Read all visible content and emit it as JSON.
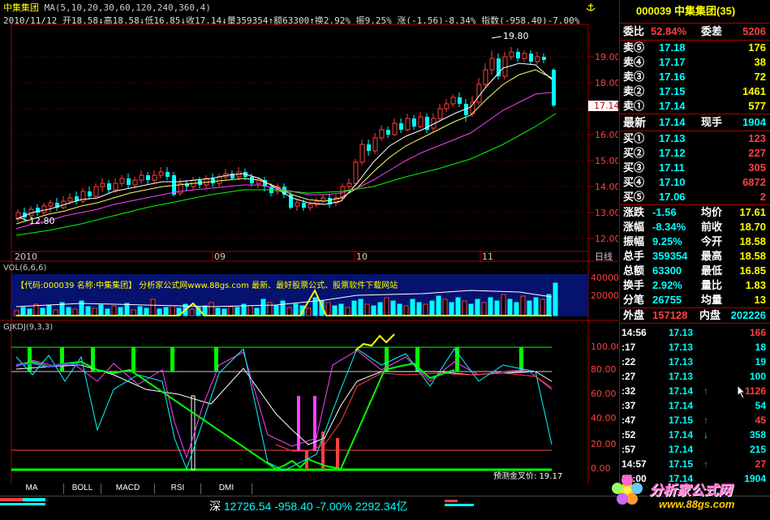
{
  "header": {
    "stock_name": "中集集团",
    "ma_label": "MA(5,10,20,30,60,120,240,360,4)",
    "info": "2010/11/12 开18.58↓高18.58↓低16.85↓收17.14↓量359354↑额63300↑换2.92% 振9.25% 涨(-1.56)-8.34% 指数(-958.40)-7.00%"
  },
  "price_chart": {
    "y_labels": [
      "19.00",
      "18.00",
      "17.00",
      "16.00",
      "15.00",
      "14.00",
      "13.00",
      "12.00"
    ],
    "high_marker": "19.80",
    "low_marker": "12.80",
    "current_price_tag": "17.14",
    "x_labels": [
      "2010",
      "09",
      "10",
      "11"
    ],
    "cycle_label": "日线"
  },
  "vol_panel": {
    "label": "VOL(6,6,6)",
    "watermark": "【代码:000039 名称:中集集团】      分析家公式网www.88gs.com 最新、最好股票公式、股票软件下载网站",
    "y_labels": [
      "400000",
      "200000"
    ]
  },
  "ind_panel": {
    "label": "GJKDJ(9,3,3)",
    "y_labels": [
      "100.00",
      "80.00",
      "60.00",
      "40.00",
      "20.00",
      "0.00"
    ],
    "forecast": "预测金叉价: 19.17"
  },
  "tabs": [
    "MA",
    "BOLL",
    "MACD",
    "RSI",
    "DMI"
  ],
  "quote": {
    "code": "000039",
    "name": "中集集团",
    "num": "(35)",
    "weibi_label": "委比",
    "weibi_val": "52.84%",
    "weicha_label": "委差",
    "weicha_val": "5206",
    "sells": [
      {
        "label": "卖⑤",
        "price": "17.18",
        "vol": "176"
      },
      {
        "label": "卖④",
        "price": "17.17",
        "vol": "38"
      },
      {
        "label": "卖③",
        "price": "17.16",
        "vol": "72"
      },
      {
        "label": "卖②",
        "price": "17.15",
        "vol": "1461"
      },
      {
        "label": "卖①",
        "price": "17.14",
        "vol": "577"
      }
    ],
    "latest_label": "最新",
    "latest_val": "17.14",
    "xianshou_label": "现手",
    "xianshou_val": "1904",
    "buys": [
      {
        "label": "买①",
        "price": "17.13",
        "vol": "123"
      },
      {
        "label": "买②",
        "price": "17.12",
        "vol": "227"
      },
      {
        "label": "买③",
        "price": "17.11",
        "vol": "305"
      },
      {
        "label": "买④",
        "price": "17.10",
        "vol": "6872"
      },
      {
        "label": "买⑤",
        "price": "17.06",
        "vol": "2"
      }
    ],
    "stats": [
      {
        "l1": "涨跌",
        "v1": "-1.56",
        "l2": "均价",
        "v2": "17.61"
      },
      {
        "l1": "涨幅",
        "v1": "-8.34%",
        "l2": "前收",
        "v2": "18.70"
      },
      {
        "l1": "振幅",
        "v1": "9.25%",
        "l2": "今开",
        "v2": "18.58"
      },
      {
        "l1": "总手",
        "v1": "359354",
        "l2": "最高",
        "v2": "18.58"
      },
      {
        "l1": "总额",
        "v1": "63300",
        "l2": "最低",
        "v2": "16.85"
      },
      {
        "l1": "换手",
        "v1": "2.92%",
        "l2": "量比",
        "v2": "1.83"
      },
      {
        "l1": "分笔",
        "v1": "26755",
        "l2": "均量",
        "v2": "13"
      }
    ],
    "waipan_label": "外盘",
    "waipan_val": "157128",
    "neipan_label": "内盘",
    "neipan_val": "202226",
    "ticks": [
      {
        "t": "14:56",
        "p": "17.13",
        "v": "166",
        "c": "#ff4040"
      },
      {
        "t": ":17",
        "p": "17.13",
        "v": "18",
        "c": "#00ffff"
      },
      {
        "t": ":22",
        "p": "17.13",
        "v": "19",
        "c": "#00ffff"
      },
      {
        "t": ":27",
        "p": "17.13",
        "v": "100",
        "c": "#00ffff"
      },
      {
        "t": ":32",
        "p": "17.14",
        "v": "1126",
        "c": "#ff4040",
        "arrow": "↑"
      },
      {
        "t": ":37",
        "p": "17.14",
        "v": "54",
        "c": "#00ffff"
      },
      {
        "t": ":47",
        "p": "17.15",
        "v": "45",
        "c": "#ff4040",
        "arrow": "↑"
      },
      {
        "t": ":52",
        "p": "17.14",
        "v": "358",
        "c": "#00ffff",
        "arrow": "↓"
      },
      {
        "t": ":57",
        "p": "17.14",
        "v": "215",
        "c": "#00ffff"
      },
      {
        "t": "14:57",
        "p": "17.15",
        "v": "27",
        "c": "#ff4040",
        "arrow": "↑"
      },
      {
        "t": "15:00",
        "p": "17.14",
        "v": "1904",
        "c": "#00ffff"
      }
    ]
  },
  "status": {
    "market": "深",
    "index": "12726.54",
    "change": "-958.40",
    "pct": "-7.00%",
    "amount": "2292.34亿"
  },
  "brand": {
    "name": "分析家公式网",
    "url": "www.88gs.com"
  }
}
